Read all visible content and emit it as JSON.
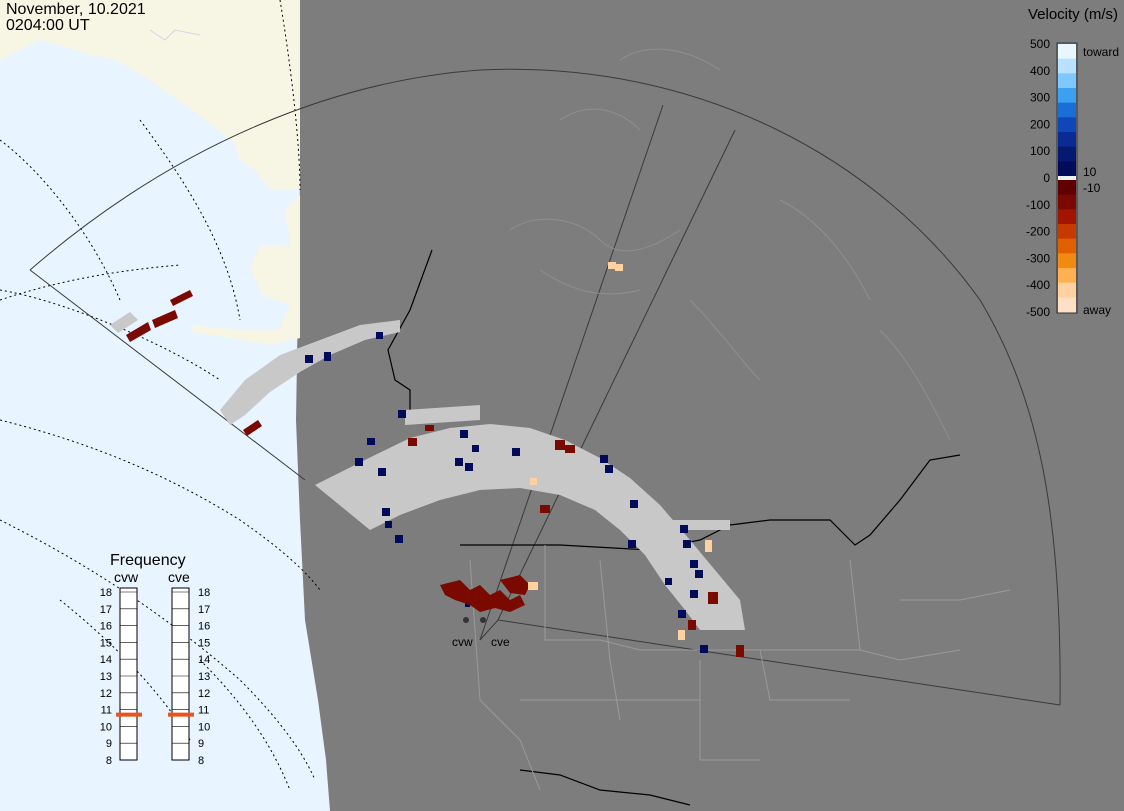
{
  "header": {
    "date": "November, 10.2021",
    "time": "0204:00 UT"
  },
  "velocity_legend": {
    "title": "Velocity (m/s)",
    "ticks": [
      "500",
      "400",
      "300",
      "200",
      "100",
      "0",
      "-100",
      "-200",
      "-300",
      "-400",
      "-500"
    ],
    "toward_label": "toward",
    "away_label": "away",
    "pos_threshold": "10",
    "neg_threshold": "-10",
    "colors_positive": [
      "#e8f6ff",
      "#b8e2ff",
      "#7fc8ff",
      "#3ca0f0",
      "#1a6fd6",
      "#1046b8",
      "#0a2a94",
      "#051a6e",
      "#000c5a"
    ],
    "colors_negative": [
      "#5e0000",
      "#7a0a00",
      "#a01400",
      "#c43a00",
      "#e06000",
      "#f08a10",
      "#ffb050",
      "#ffd0a0",
      "#ffe0c4"
    ]
  },
  "frequency_legend": {
    "title": "Frequency",
    "stations": [
      "cvw",
      "cve"
    ],
    "levels": [
      "18",
      "17",
      "16",
      "15",
      "14",
      "13",
      "12",
      "11",
      "10",
      "9",
      "8"
    ],
    "selected": {
      "cvw": 10.7,
      "cve": 10.7
    },
    "marker_color": "#e8541c"
  },
  "radar_sites": [
    "cvw",
    "cve"
  ],
  "colors": {
    "land": "#7d7d7d",
    "ocean": "#e8f4ff",
    "night_land": "#f7f5e4",
    "ground_scatter": "#c8c8c8",
    "borders": "#000000",
    "fov_lines": "#3a3a3a"
  }
}
